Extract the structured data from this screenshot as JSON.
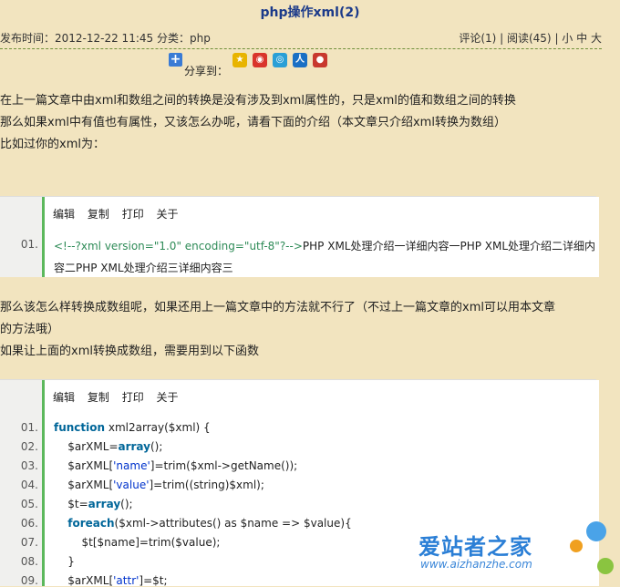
{
  "title": "php操作xml(2)",
  "meta": {
    "published": "发布时间：2012-12-22 11:45",
    "category": "分类：php",
    "comments": "评论(1)",
    "reads": "阅读(45)",
    "font_small": "小",
    "font_medium": "中",
    "font_large": "大"
  },
  "share": {
    "label": "分享到："
  },
  "intro": {
    "line1": "在上一篇文章中由xml和数组之间的转换是没有涉及到xml属性的，只是xml的值和数组之间的转换",
    "line2": "那么如果xml中有值也有属性，又该怎么办呢，请看下面的介绍（本文章只介绍xml转换为数组）",
    "line3": "比如过你的xml为："
  },
  "toolbar": {
    "edit": "编辑",
    "copy": "复制",
    "print": "打印",
    "about": "关于"
  },
  "code1": {
    "line_no": "01.",
    "decl": "<!--?xml version=\"1.0\" encoding=\"utf-8\"?-->",
    "text_a": "PHP XML处理介绍一详细内容一PHP XML处理介绍二详细内",
    "text_b": "容二PHP XML处理介绍三详细内容三"
  },
  "mid": {
    "line1": "那么该怎么样转换成数组呢，如果还用上一篇文章中的方法就不行了（不过上一篇文章的xml可以用本文章",
    "line2": "的方法哦）",
    "line3": "如果让上面的xml转换成数组，需要用到以下函数"
  },
  "code2": {
    "lines": [
      {
        "no": "01.",
        "a": "function",
        "b": " xml2array($xml) {"
      },
      {
        "no": "02.",
        "a": "    $arXML=",
        "k": "array",
        "b": "();"
      },
      {
        "no": "03.",
        "a": "    $arXML[",
        "s": "'name'",
        "b": "]=trim($xml->getName());"
      },
      {
        "no": "04.",
        "a": "    $arXML[",
        "s": "'value'",
        "b": "]=trim((string)$xml);"
      },
      {
        "no": "05.",
        "a": "    $t=",
        "k": "array",
        "b": "();"
      },
      {
        "no": "06.",
        "a": "    ",
        "k": "foreach",
        "b": "($xml->attributes() as $name => $value){"
      },
      {
        "no": "07.",
        "a": "        $t[$name]=trim($value);"
      },
      {
        "no": "08.",
        "a": "    }"
      },
      {
        "no": "09.",
        "a": "    $arXML[",
        "s": "'attr'",
        "b": "]=$t;"
      }
    ]
  },
  "watermark": {
    "cn": "爱站者之家",
    "en": "www.aizhanzhe.com"
  },
  "colors": {
    "background": "#f2e4bf",
    "title": "#1b3a8a",
    "accent": "#5cb85c"
  }
}
